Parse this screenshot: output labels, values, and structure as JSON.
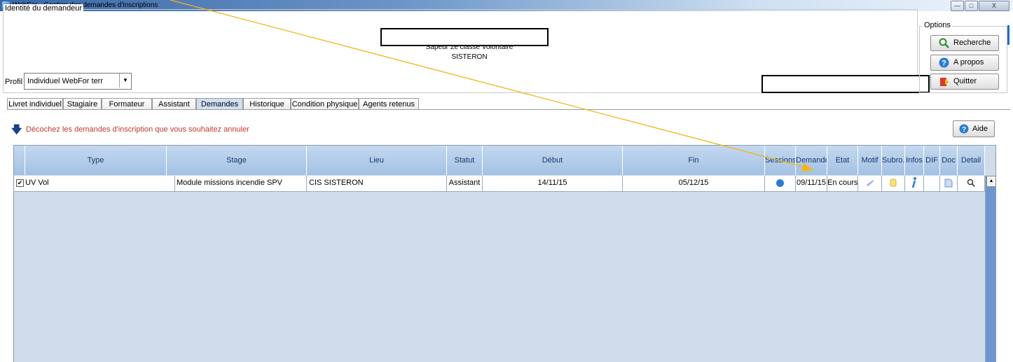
{
  "window": {
    "title": "WebFor - Gestion des demandes d'inscriptions",
    "buttons": [
      "—",
      "□",
      "X"
    ]
  },
  "identity": {
    "legend": "Identité du demandeur",
    "grade": "Sapeur 2è classe Volontaire",
    "city": "SISTERON",
    "profil_label": "Profil",
    "profil_value": "Individuel WebFor terr"
  },
  "options": {
    "legend": "Options",
    "search_label": "Recherche",
    "about_label": "A propos",
    "quit_label": "Quitter"
  },
  "tabs": [
    {
      "label": "Livret individuel"
    },
    {
      "label": "Stagiaire"
    },
    {
      "label": "Formateur"
    },
    {
      "label": "Assistant"
    },
    {
      "label": "Demandes",
      "active": true
    },
    {
      "label": "Historique"
    },
    {
      "label": "Condition physique"
    },
    {
      "label": "Agents retenus"
    }
  ],
  "hint": {
    "text": "Décochez les demandes d'inscription que vous souhaitez annuler",
    "color": "#c0392b"
  },
  "help_label": "Aide",
  "table": {
    "headers": [
      "Type",
      "Stage",
      "Lieu",
      "Statut",
      "Début",
      "Fin",
      "Sessions",
      "Demande",
      "Etat",
      "Motif",
      "Subro.",
      "Infos",
      "DIF",
      "Doc",
      "Detail"
    ],
    "rows": [
      {
        "checked": true,
        "type": "UV Vol",
        "stage": "Module missions incendie SPV",
        "lieu": "CIS SISTERON",
        "statut": "Assistant",
        "debut": "14/11/15",
        "fin": "05/12/15",
        "demande": "09/11/15",
        "etat": "En cours"
      }
    ]
  },
  "annotation_color": "#f2b418"
}
